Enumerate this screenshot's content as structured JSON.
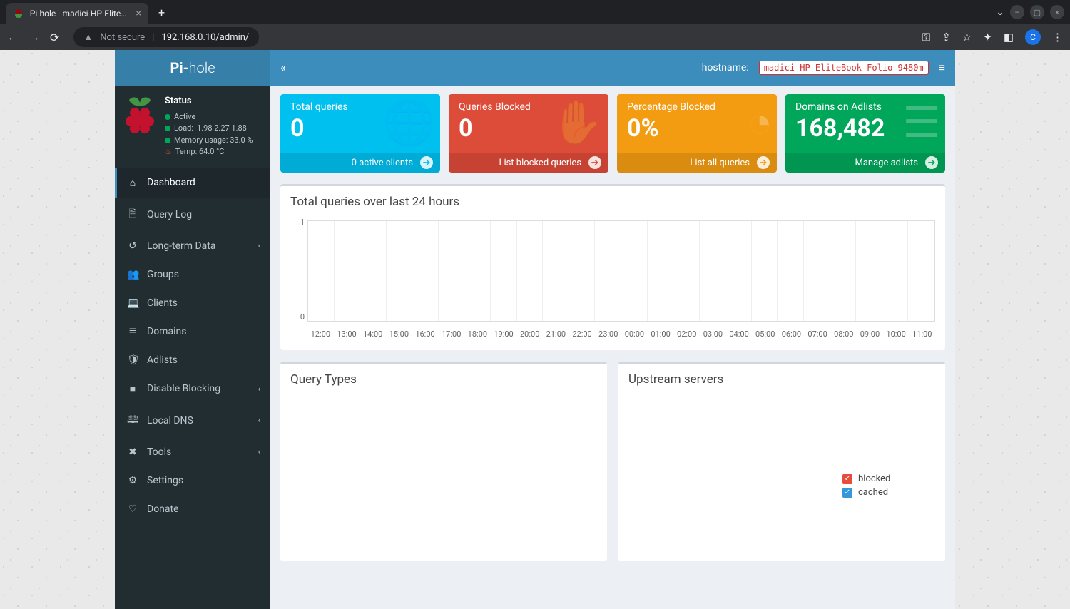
{
  "browser": {
    "tab_title": "Pi-hole - madici-HP-EliteB…",
    "url_prefix": "Not secure",
    "url": "192.168.0.10/admin/",
    "avatar": "C"
  },
  "header": {
    "logo_left": "Pi-",
    "logo_right": "hole",
    "hostname_label": "hostname:",
    "hostname": "madici-HP-EliteBook-Folio-9480m"
  },
  "status": {
    "title": "Status",
    "active": "Active",
    "load_label": "Load:",
    "load": "1.98  2.27  1.88",
    "memory": "Memory usage:  33.0 %",
    "temp": "Temp: 64.0 °C"
  },
  "nav": {
    "dashboard": "Dashboard",
    "query_log": "Query Log",
    "long_term": "Long-term Data",
    "groups": "Groups",
    "clients": "Clients",
    "domains": "Domains",
    "adlists": "Adlists",
    "disable": "Disable Blocking",
    "local_dns": "Local DNS",
    "tools": "Tools",
    "settings": "Settings",
    "donate": "Donate"
  },
  "stats": {
    "total": {
      "label": "Total queries",
      "value": "0",
      "footer": "0 active clients"
    },
    "blocked": {
      "label": "Queries Blocked",
      "value": "0",
      "footer": "List blocked queries"
    },
    "percent": {
      "label": "Percentage Blocked",
      "value": "0%",
      "footer": "List all queries"
    },
    "domains": {
      "label": "Domains on Adlists",
      "value": "168,482",
      "footer": "Manage adlists"
    }
  },
  "panels": {
    "chart_title": "Total queries over last 24 hours",
    "query_types": "Query Types",
    "upstream": "Upstream servers",
    "legend_blocked": "blocked",
    "legend_cached": "cached"
  },
  "chart_data": {
    "type": "line",
    "title": "Total queries over last 24 hours",
    "ylim": [
      0,
      1
    ],
    "y_ticks": [
      "1",
      "0"
    ],
    "x_ticks": [
      "12:00",
      "13:00",
      "14:00",
      "15:00",
      "16:00",
      "17:00",
      "18:00",
      "19:00",
      "20:00",
      "21:00",
      "22:00",
      "23:00",
      "00:00",
      "01:00",
      "02:00",
      "03:00",
      "04:00",
      "05:00",
      "06:00",
      "07:00",
      "08:00",
      "09:00",
      "10:00",
      "11:00"
    ],
    "series": []
  }
}
